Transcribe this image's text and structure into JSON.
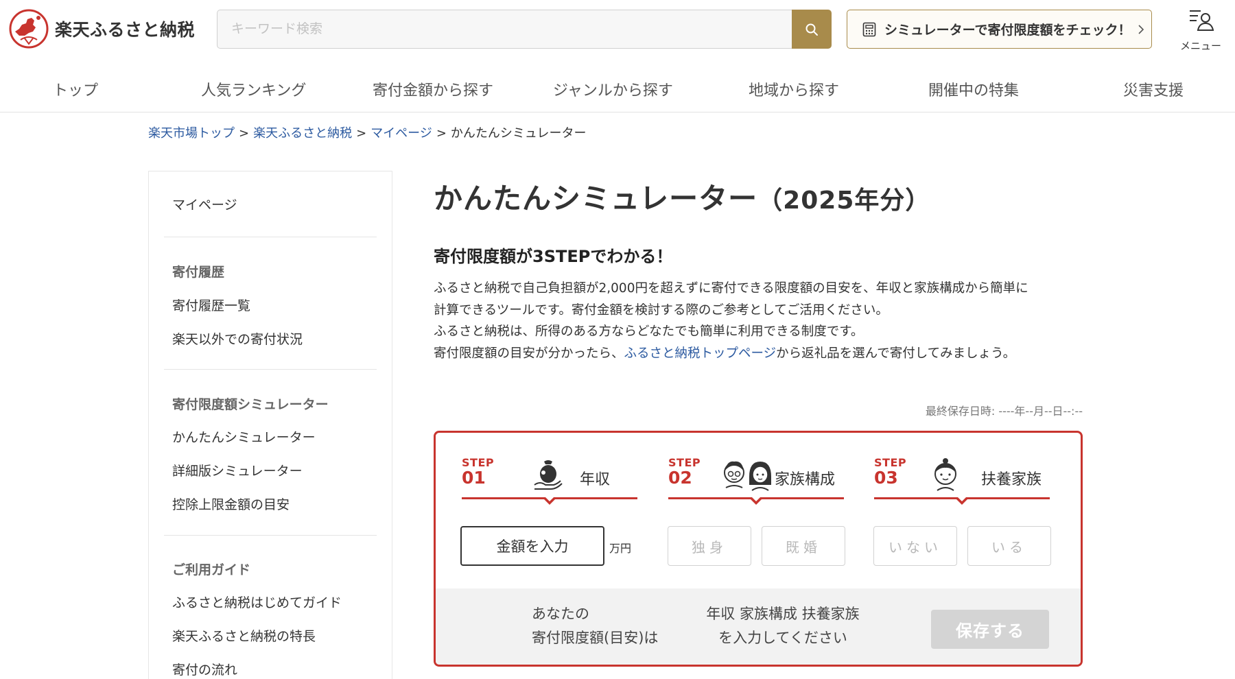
{
  "header": {
    "logo_text": "楽天ふるさと納税",
    "search_placeholder": "キーワード検索",
    "search_icon": "search-icon",
    "simulator_button_label": "シミュレーターで寄付限度額をチェック！",
    "menu_label": "メニュー"
  },
  "nav": {
    "items": [
      "トップ",
      "人気ランキング",
      "寄付金額から探す",
      "ジャンルから探す",
      "地域から探す",
      "開催中の特集",
      "災害支援"
    ]
  },
  "breadcrumb": {
    "items": [
      "楽天市場トップ",
      "楽天ふるさと納税",
      "マイページ"
    ],
    "current": "かんたんシミュレーター",
    "separator": ">"
  },
  "sidebar": {
    "mypage": "マイページ",
    "sections": [
      {
        "heading": "寄付履歴",
        "items": [
          "寄付履歴一覧",
          "楽天以外での寄付状況"
        ]
      },
      {
        "heading": "寄付限度額シミュレーター",
        "items": [
          "かんたんシミュレーター",
          "詳細版シミュレーター",
          "控除上限金額の目安"
        ]
      },
      {
        "heading": "ご利用ガイド",
        "items": [
          "ふるさと納税はじめてガイド",
          "楽天ふるさと納税の特長",
          "寄付の流れ"
        ]
      }
    ]
  },
  "main": {
    "title": "かんたんシミュレーター",
    "title_year": "（2025年分）",
    "subtitle": "寄付限度額が3STEPでわかる！",
    "desc_line1": "ふるさと納税で自己負担額が2,000円を超えずに寄付できる限度額の目安を、年収と家族構成から簡単に",
    "desc_line2": "計算できるツールです。寄付金額を検討する際のご参考としてご活用ください。",
    "desc_line3": "ふるさと納税は、所得のある方ならどなたでも簡単に利用できる制度です。",
    "desc_line4_pre": "寄付限度額の目安が分かったら、",
    "desc_line4_link": "ふるさと納税トップページ",
    "desc_line4_post": "から返礼品を選んで寄付してみましょう。",
    "last_saved": "最終保存日時: ----年--月--日--:--"
  },
  "simulator": {
    "steps": [
      {
        "tag": "STEP",
        "num": "01",
        "label": "年収",
        "icon": "money-bag-hand-icon"
      },
      {
        "tag": "STEP",
        "num": "02",
        "label": "家族構成",
        "icon": "couple-icon"
      },
      {
        "tag": "STEP",
        "num": "03",
        "label": "扶養家族",
        "icon": "child-icon"
      }
    ],
    "amount_button": "金額を入力",
    "unit": "万円",
    "family_options": [
      "独身",
      "既婚"
    ],
    "dependent_options": [
      "いない",
      "いる"
    ],
    "result_label_line1": "あなたの",
    "result_label_line2": "寄付限度額(目安)は",
    "result_value_line1": "年収 家族構成 扶養家族",
    "result_value_line2": "を入力してください",
    "save_button": "保存する"
  },
  "colors": {
    "accent_gold": "#a88b4b",
    "accent_red": "#c8342e",
    "link_blue": "#2c5aa0"
  }
}
